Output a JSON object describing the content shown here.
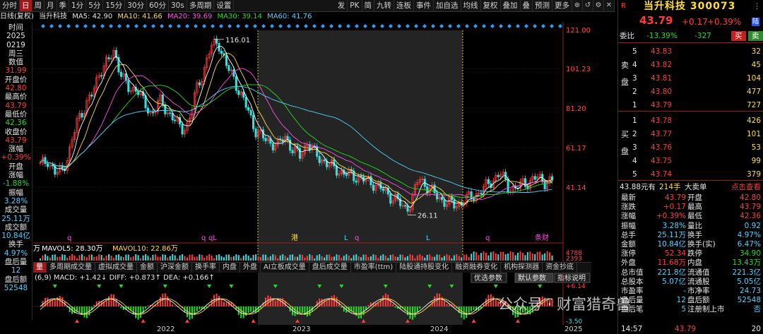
{
  "toolbar": {
    "periods": [
      "分时",
      "日",
      "周",
      "月",
      "季",
      "1分",
      "5分",
      "15分",
      "30分",
      "60分",
      "30s",
      "多周期",
      "设置"
    ],
    "active_period": "日",
    "right_buttons": [
      "发",
      "PK",
      "简",
      "九转",
      "连板",
      "事件"
    ],
    "tools": [
      "加自选",
      "均线",
      "复权",
      "叠加",
      "叠",
      "预测",
      "更多"
    ]
  },
  "info": {
    "mode": "日线(复权)",
    "name": "当升科技",
    "ma5": "MA5: 42.90",
    "ma10": "MA10: 41.66",
    "ma20": "MA20: 39.69",
    "ma30": "MA30: 39.14",
    "ma60": "MA60: 41.76"
  },
  "left_panel": [
    {
      "t": "时间",
      "c": "wht"
    },
    {
      "t": "2025",
      "c": "wht"
    },
    {
      "t": "0219",
      "c": "wht"
    },
    {
      "t": "周三",
      "c": "wht"
    },
    {
      "t": "数值",
      "c": "wht"
    },
    {
      "t": "31.99",
      "c": "red"
    },
    {
      "t": "开盘价",
      "c": "wht"
    },
    {
      "t": "42.80",
      "c": "red"
    },
    {
      "t": "最高价",
      "c": "wht"
    },
    {
      "t": "43.79",
      "c": "red"
    },
    {
      "t": "最低价",
      "c": "wht"
    },
    {
      "t": "42.36",
      "c": "grn"
    },
    {
      "t": "收盘价",
      "c": "wht"
    },
    {
      "t": "43.79",
      "c": "red"
    },
    {
      "t": "涨幅",
      "c": "wht"
    },
    {
      "t": "+0.39%",
      "c": "red"
    },
    {
      "t": "开盘",
      "c": "wht"
    },
    {
      "t": "涨幅",
      "c": "wht"
    },
    {
      "t": "-1.88%",
      "c": "grn"
    },
    {
      "t": "振幅",
      "c": "wht"
    },
    {
      "t": "3.28%",
      "c": "cyn"
    },
    {
      "t": "成交量",
      "c": "wht"
    },
    {
      "t": "25.11万",
      "c": "cyn"
    },
    {
      "t": "成交额",
      "c": "wht"
    },
    {
      "t": "10.84亿",
      "c": "cyn"
    },
    {
      "t": "换手",
      "c": "wht"
    },
    {
      "t": "4.97%",
      "c": "cyn"
    },
    {
      "t": "盘后量",
      "c": "wht"
    },
    {
      "t": "12",
      "c": "cyn"
    },
    {
      "t": "盘后额",
      "c": "wht"
    },
    {
      "t": "52548",
      "c": "cyn"
    }
  ],
  "chart_data": {
    "type": "line",
    "title": "当升科技 300073 日线(复权)",
    "y_ticks": [
      "121.00",
      "101.23",
      "81.20",
      "61.17",
      "41.14"
    ],
    "y_range": [
      20,
      122
    ],
    "x_labels": [
      "2022",
      "2023",
      "2024",
      "2025"
    ],
    "annotations": {
      "high": "116.01",
      "low": "26.11"
    },
    "markers": [
      "q",
      "q",
      "qL",
      "港",
      "L",
      "q",
      "L",
      "q",
      "条财"
    ],
    "series": [
      {
        "type": "close",
        "values": [
          52,
          55,
          48,
          50,
          60,
          75,
          82,
          88,
          100,
          104,
          110,
          97,
          90,
          92,
          83,
          78,
          85,
          80,
          76,
          70,
          74,
          90,
          100,
          112,
          115,
          103,
          97,
          88,
          80,
          70,
          66,
          64,
          62,
          67,
          60,
          57,
          64,
          58,
          55,
          52,
          50,
          48,
          47,
          46,
          44,
          43,
          40,
          37,
          35,
          30,
          33,
          46,
          42,
          38,
          35,
          33,
          32,
          34,
          36,
          38,
          41,
          45,
          48,
          42,
          40,
          43,
          44,
          46,
          44,
          43.79
        ]
      }
    ],
    "volume_labels": {
      "mavol5": "MAVOL5: 28.30万",
      "mavol10": "MAVOL10: 22.86万",
      "unit": "万",
      "axis_top": "4788",
      "axis_bottom": "2393"
    },
    "macd": {
      "label": "(6,9) MACD: +1.42↓  DIFF: +0.873↑  DEA: +0.166↑",
      "top_tick": "+6.14",
      "bottom_tick": "-3.50"
    }
  },
  "tabs": [
    "量",
    "多周期成交量",
    "虚拟成交量",
    "金额",
    "沪深金额",
    "换手率",
    "内盘",
    "外盘",
    "AI立板成交量",
    "盘后成交量",
    "市盈率(ttm)",
    "陆股通持股变化",
    "融资融券变化",
    "机构探测器",
    "资金抄底"
  ],
  "tab_buttons": [
    "优选参数",
    "默认参数",
    "指标说明"
  ],
  "right": {
    "flag": "R",
    "stock_name": "当升科技",
    "code": "300073",
    "price": "43.79",
    "change": "+0.17",
    "change_pct": "+0.39%",
    "badge": "陆",
    "weibi_label": "委比",
    "weibi": "-13.39%",
    "weicha": "-327",
    "buy_btn": "买",
    "sell_btn": "卖",
    "sell_side": "卖盘",
    "buy_side": "买盘",
    "asks": [
      {
        "lv": "5",
        "px": "43.83",
        "vol": "32"
      },
      {
        "lv": "4",
        "px": "43.82",
        "vol": "45"
      },
      {
        "lv": "3",
        "px": "43.81",
        "vol": "104"
      },
      {
        "lv": "2",
        "px": "43.80",
        "vol": "477"
      },
      {
        "lv": "1",
        "px": "43.79",
        "vol": "727"
      }
    ],
    "bids": [
      {
        "lv": "1",
        "px": "43.78",
        "vol": "426"
      },
      {
        "lv": "2",
        "px": "43.77",
        "vol": "101"
      },
      {
        "lv": "3",
        "px": "43.76",
        "vol": "53"
      },
      {
        "lv": "4",
        "px": "43.75",
        "vol": "99"
      },
      {
        "lv": "5",
        "px": "43.74",
        "vol": "379"
      }
    ],
    "big_order": {
      "price": "43.88元有",
      "qty": "214手",
      "label": "大卖单",
      "link": "点击查看"
    },
    "stats": [
      [
        "最新",
        "43.79",
        "开盘",
        "42.80"
      ],
      [
        "涨跌",
        "+0.17",
        "最高",
        "43.79"
      ],
      [
        "涨幅",
        "+0.39%",
        "最低",
        "42.36"
      ],
      [
        "振幅",
        "3.28%",
        "量比",
        "0.92"
      ],
      [
        "总手",
        "25.11万",
        "换手",
        "4.97%"
      ],
      [
        "金额",
        "10.84亿",
        "换手(实)",
        "6.47%"
      ],
      [
        "涨停",
        "52.34",
        "跌停",
        "34.90"
      ],
      [
        "外盘",
        "11.68万",
        "内盘",
        "13.43万"
      ],
      [
        "总市值",
        "221.8亿",
        "流通值",
        "221.3亿"
      ],
      [
        "总股本",
        "5.07亿",
        "流通股",
        "5.05亿"
      ],
      [
        "市盈率",
        "-",
        "市净率",
        "24.73"
      ],
      [
        "盘后量",
        "12",
        "盘后额",
        "52548"
      ],
      [
        "盘后笔",
        "5",
        "注册制上市",
        "否"
      ]
    ],
    "time": "14:57",
    "time_price": "43.79",
    "time_vol": "20"
  },
  "watermark": "公众号 · 财富猎奇兽"
}
